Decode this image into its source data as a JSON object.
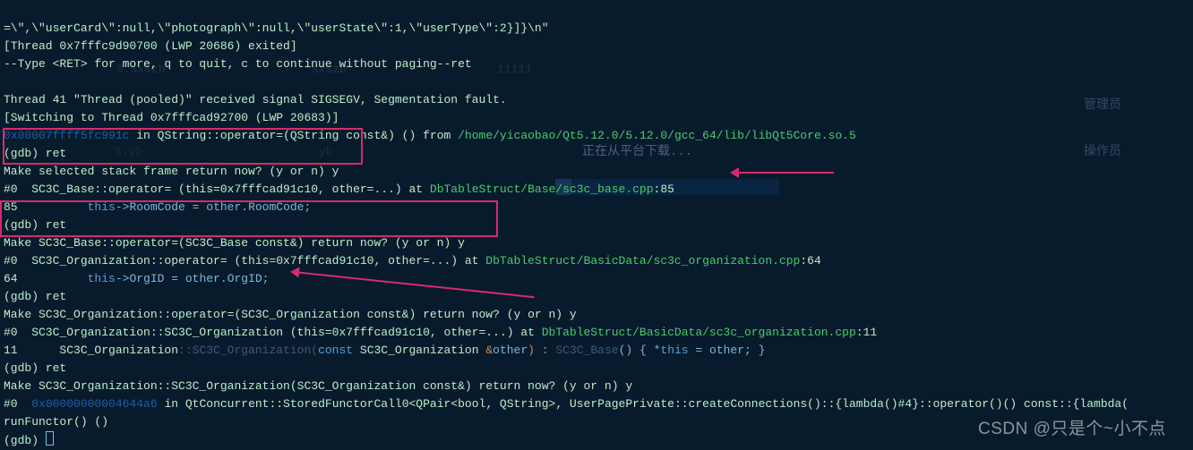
{
  "lines": {
    "l1a": "=\\\",\\\"userCard\\\":null,\\\"photograph\\\":null,\\\"userState\\\":1,\\\"userType\\\":2}]}\\n\"",
    "l2": "[Thread 0x7fffc9d90700 (LWP 20686) exited]",
    "l3": "--Type <RET> for more, q to quit, c to continue without paging--ret",
    "l5": "Thread 41 \"Thread (pooled)\" received signal SIGSEGV, Segmentation fault.",
    "l6": "[Switching to Thread 0x7fffcad92700 (LWP 20683)]",
    "l7addr": "0x00007ffff5fc991c",
    "l7a": " in QString::operator=(QString const&) () from ",
    "l7b": "/home/yicaobao/Qt5.12.0/5.12.0/gcc_64/lib/libQt5Core.so.5",
    "l8": "(gdb) ret",
    "l9": "Make selected stack frame return now? (y or n) y",
    "l10a": "#0  SC3C_Base::operator= (this=0x7fffcad91c10, other=...) at ",
    "l10b": "DbTableStruct/Base/sc3c_base.cpp",
    "l10c": ":85",
    "l11n": "85          ",
    "l11this": "this",
    "l11arrow": "->",
    "l11a": "RoomCode = other.RoomCode;",
    "l12": "(gdb) ret",
    "l13": "Make SC3C_Base::operator=(SC3C_Base const&) return now? (y or n) y",
    "l14a": "#0  SC3C_Organization::operator= (this=0x7fffcad91c10, other=...) at ",
    "l14b": "DbTableStruct/BasicData/sc3c_organization.cpp",
    "l14c": ":64",
    "l15n": "64          ",
    "l15a": "OrgID = other.OrgID;",
    "l16": "(gdb) ret",
    "l17": "Make SC3C_Organization::operator=(SC3C_Organization const&) return now? (y or n) y",
    "l18a": "#0  SC3C_Organization::SC3C_Organization (this=0x7fffcad91c10, other=...) at ",
    "l18b": "DbTableStruct/BasicData/sc3c_organization.cpp",
    "l18c": ":11",
    "l19n": "11      SC3C_Organization",
    "l19f": "::SC3C_Organization(",
    "l19c": "const",
    "l19p": " SC3C_Organization ",
    "l19amp": "&",
    "l19o": "other",
    "l19p2": ") : ",
    "l19base": "SC3C_Base",
    "l19p3": "() { *",
    "l19this": "this",
    "l19eq": " = other; }",
    "l20": "(gdb) ret",
    "l21": "Make SC3C_Organization::SC3C_Organization(SC3C_Organization const&) return now? (y or n) y",
    "l22addr": "0x00000000004644a6",
    "l22a": "#0  ",
    "l22b": " in QtConcurrent::StoredFunctorCall0<QPair<bool, QString>, UserPagePrivate::createConnections()::{lambda()#4}::operator()() const::{lambda(",
    "l23": "runFunctor() ()",
    "l24": "(gdb) "
  },
  "ui": {
    "download": "正在从平台下载...",
    "role1": "管理员",
    "role2": "操作员",
    "tab1": "3.sxszb",
    "tab2": "sxszb",
    "tab3": "11111",
    "sub1": "3.yb",
    "sub2": "yb"
  },
  "watermark": "CSDN @只是个~小不点"
}
